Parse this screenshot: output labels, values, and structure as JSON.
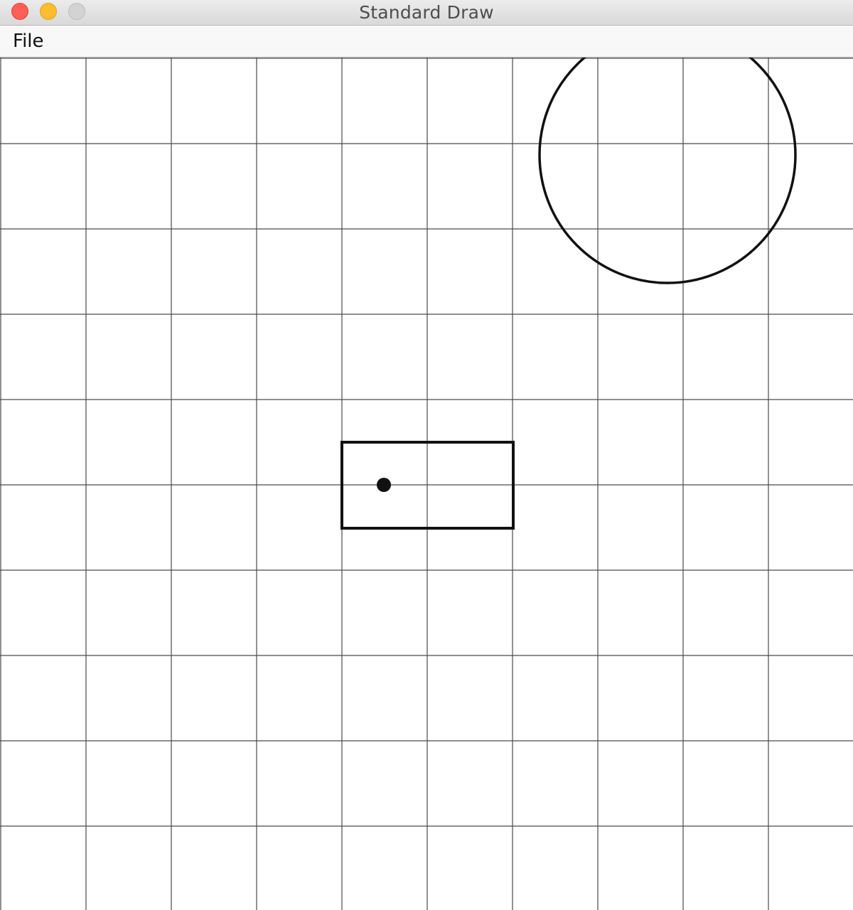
{
  "window": {
    "title": "Standard Draw"
  },
  "menubar": {
    "items": [
      {
        "label": "File"
      }
    ]
  },
  "canvas": {
    "background": "#ffffff",
    "grid_color": "#4a4a4a",
    "shape_color": "#111111",
    "grid_divisions": 10,
    "shapes": [
      {
        "kind": "circle",
        "name": "drawn-circle"
      },
      {
        "kind": "rectangle",
        "name": "drawn-rectangle"
      },
      {
        "kind": "point",
        "name": "drawn-point"
      }
    ]
  },
  "colors": {
    "close": "#fe5f57",
    "minimize": "#febc2e",
    "zoom": "#d3d3d3"
  }
}
